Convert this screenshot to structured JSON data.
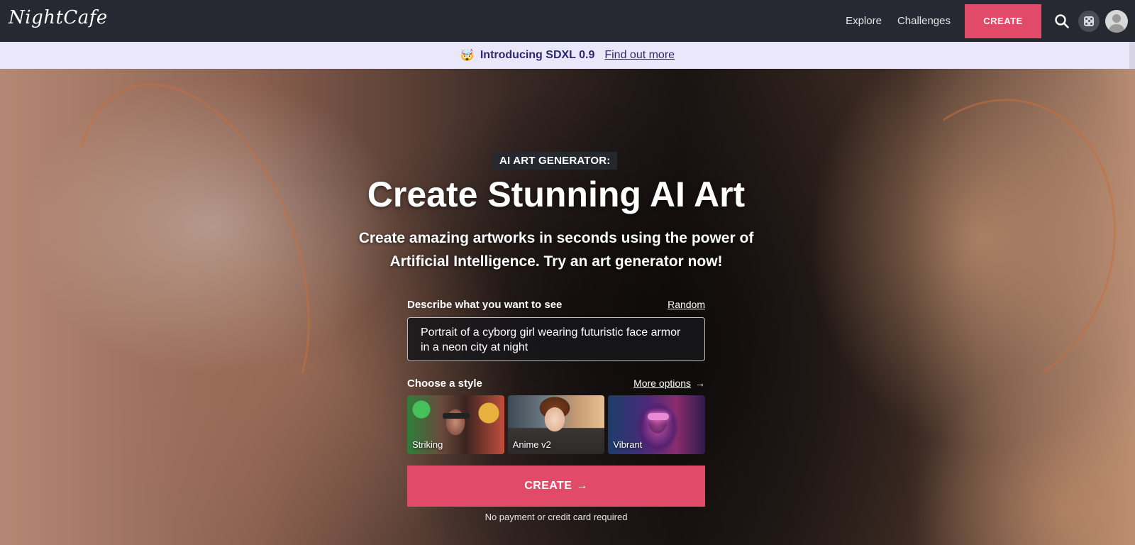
{
  "nav": {
    "logo": "NightCafe",
    "links": [
      "Explore",
      "Challenges"
    ],
    "create_label": "CREATE",
    "icons": [
      "search-icon",
      "dice-icon",
      "avatar-icon"
    ]
  },
  "announcement": {
    "emoji": "🤯",
    "title": "Introducing SDXL 0.9",
    "link": "Find out more"
  },
  "hero": {
    "eyebrow": "AI ART GENERATOR:",
    "headline": "Create Stunning AI Art",
    "subhead_line1": "Create amazing artworks in seconds using the power of",
    "subhead_line2": "Artificial Intelligence. Try an art generator now!"
  },
  "form": {
    "prompt_label": "Describe what you want to see",
    "random_label": "Random",
    "prompt_value": "Portrait of a cyborg girl wearing futuristic face armor in a neon city at night",
    "style_label": "Choose a style",
    "more_options_label": "More options",
    "styles": [
      {
        "name": "Striking"
      },
      {
        "name": "Anime v2"
      },
      {
        "name": "Vibrant"
      }
    ],
    "create_label": "CREATE",
    "footnote": "No payment or credit card required"
  },
  "colors": {
    "accent": "#e24a6a",
    "nav_bg": "#262932",
    "announce_bg": "#ebe7fb"
  }
}
